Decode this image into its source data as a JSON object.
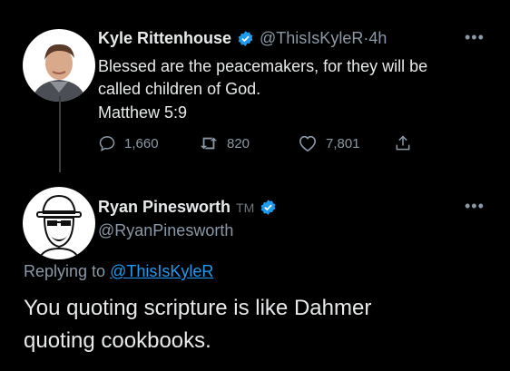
{
  "tweet": {
    "display_name": "Kyle Rittenhouse",
    "handle": "@ThisIsKyleR",
    "time_separator": " · ",
    "time": "4h",
    "text_lines": [
      "Blessed are the peacemakers, for they will be",
      "called children of God.",
      "Matthew 5:9"
    ],
    "replies": "1,660",
    "retweets": "820",
    "likes": "7,801"
  },
  "reply": {
    "display_name": "Ryan Pinesworth",
    "tm": "TM",
    "handle": "@RyanPinesworth",
    "replying_to_label": "Replying to",
    "replying_to_mention": "@ThisIsKyleR",
    "text_lines": [
      "You quoting scripture is like Dahmer",
      "quoting cookbooks."
    ]
  },
  "icons": {
    "verified": "verified-badge-icon",
    "more": "more-icon",
    "reply": "reply-icon",
    "retweet": "retweet-icon",
    "like": "heart-icon",
    "share": "share-icon"
  },
  "colors": {
    "background": "#000000",
    "text": "#e7e9ea",
    "secondary": "#8b98a5",
    "accent": "#1d9bf0"
  }
}
